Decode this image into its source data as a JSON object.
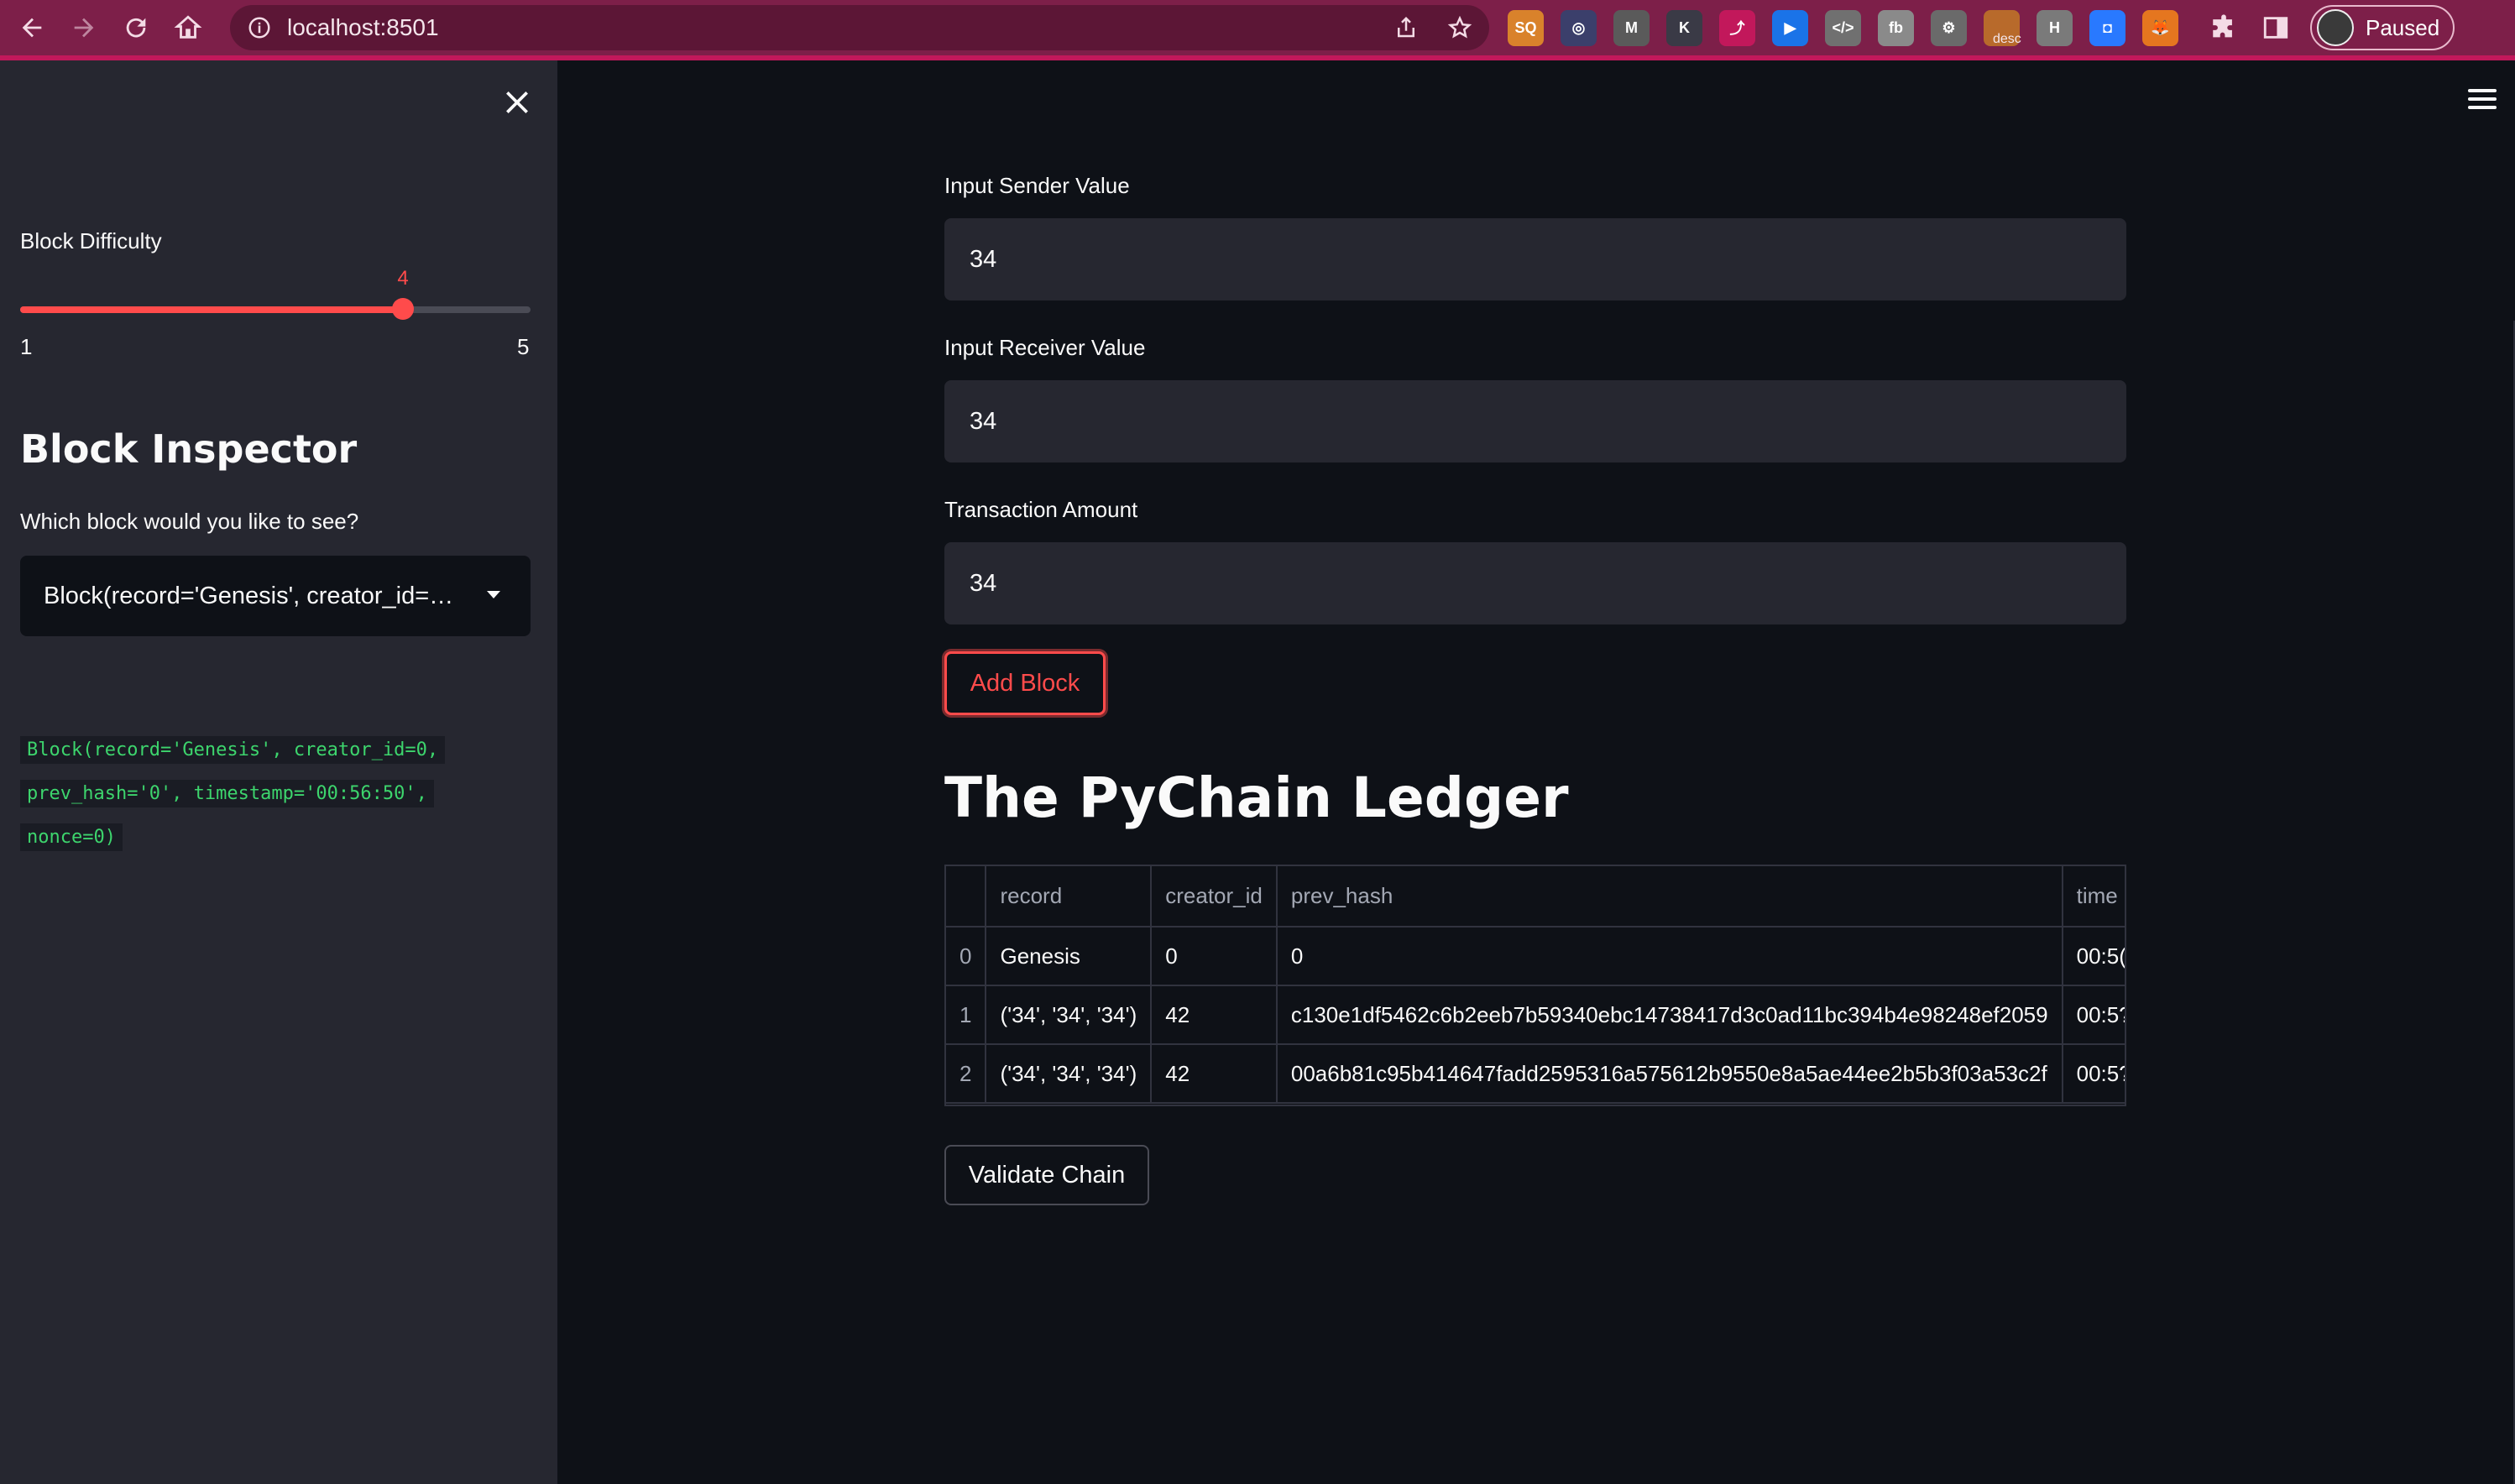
{
  "browser": {
    "url": "localhost:8501",
    "profile_label": "Paused",
    "extension_label": "desc",
    "accent": "#7d1f49",
    "extensions": [
      {
        "name": "ext-sq",
        "text": "SQ",
        "color": "#d9822b"
      },
      {
        "name": "ext-circle",
        "text": "◎",
        "color": "#3b3f6b"
      },
      {
        "name": "ext-m",
        "text": "M",
        "color": "#5a5a5a"
      },
      {
        "name": "ext-k",
        "text": "K",
        "color": "#3a3a46"
      },
      {
        "name": "ext-cast",
        "text": "⤴",
        "color": "#c2185b"
      },
      {
        "name": "ext-video",
        "text": "▶",
        "color": "#1a73e8"
      },
      {
        "name": "ext-code",
        "text": "</>",
        "color": "#707070"
      },
      {
        "name": "ext-fb",
        "text": "fb",
        "color": "#8a8a8a"
      },
      {
        "name": "ext-paint",
        "text": "⚙",
        "color": "#6a6a6a"
      },
      {
        "name": "ext-desc",
        "text": "",
        "color": "#b86a2b"
      },
      {
        "name": "ext-hs",
        "text": "H",
        "color": "#7a7a7a"
      },
      {
        "name": "ext-blue",
        "text": "◘",
        "color": "#2979ff"
      },
      {
        "name": "ext-fox",
        "text": "🦊",
        "color": "#e5761f"
      }
    ]
  },
  "sidebar": {
    "difficulty_label": "Block Difficulty",
    "slider": {
      "min": 1,
      "max": 5,
      "value": 4,
      "min_label": "1",
      "max_label": "5",
      "value_label": "4"
    },
    "inspector_heading": "Block Inspector",
    "select_label": "Which block would you like to see?",
    "select_value": "Block(record='Genesis', creator_id=…",
    "code_lines": [
      "Block(record='Genesis', creator_id=0,",
      "prev_hash='0', timestamp='00:56:50',",
      "nonce=0)"
    ]
  },
  "form": {
    "sender_label": "Input Sender Value",
    "sender_value": "34",
    "receiver_label": "Input Receiver Value",
    "receiver_value": "34",
    "amount_label": "Transaction Amount",
    "amount_value": "34",
    "add_button": "Add Block"
  },
  "ledger": {
    "title": "The PyChain Ledger",
    "columns": [
      "",
      "record",
      "creator_id",
      "prev_hash",
      "time"
    ],
    "rows": [
      [
        "0",
        "Genesis",
        "0",
        "0",
        "00:5("
      ],
      [
        "1",
        "('34', '34', '34')",
        "42",
        "c130e1df5462c6b2eeb7b59340ebc14738417d3c0ad11bc394b4e98248ef2059",
        "00:5?"
      ],
      [
        "2",
        "('34', '34', '34')",
        "42",
        "00a6b81c95b414647fadd2595316a575612b9550e8a5ae44ee2b5b3f03a53c2f",
        "00:5?"
      ]
    ],
    "validate_button": "Validate Chain"
  },
  "colors": {
    "primary": "#ff4b4b",
    "sidebar_bg": "#262730",
    "main_bg": "#0e1117",
    "code_text": "#3dd56d"
  }
}
